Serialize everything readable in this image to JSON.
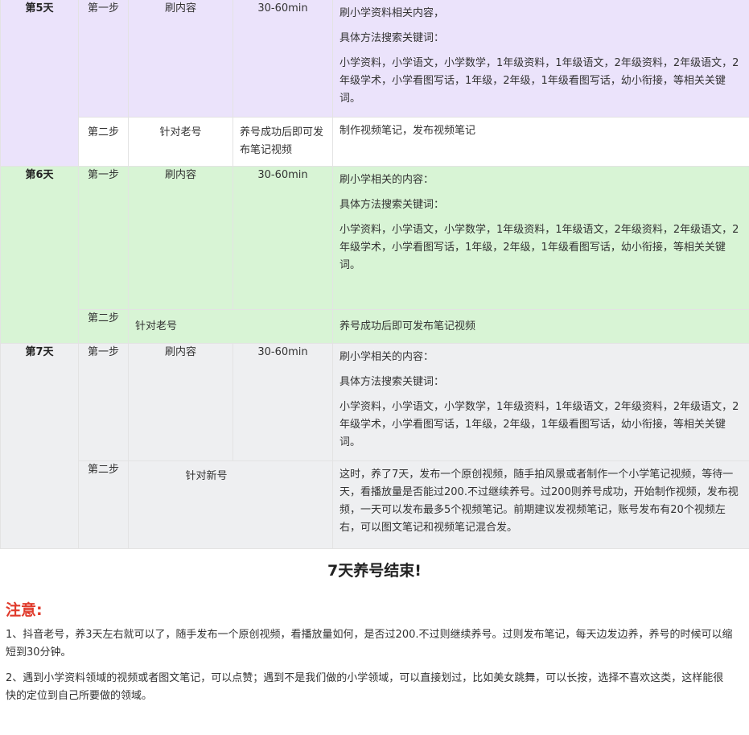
{
  "colors": {
    "day5": "#ebe3fb",
    "day6": "#d8f4d5",
    "day7": "#eeeff1",
    "notice": "#e03a2b"
  },
  "days": [
    {
      "label": "第5天",
      "step1": {
        "step": "第一步",
        "action": "刷内容",
        "time": "30-60min",
        "desc": [
          "刷小学资料相关内容，",
          "具体方法搜索关键词：",
          "小学资料，小学语文，小学数学，1年级资料，1年级语文，2年级资料，2年级语文，2年级学术，小学看图写话，1年级，2年级，1年级看图写话，幼小衔接，等相关关键词。"
        ]
      },
      "step2": {
        "step": "第二步",
        "action": "针对老号",
        "time": "养号成功后即可发布笔记视频",
        "desc": "制作视频笔记，发布视频笔记"
      }
    },
    {
      "label": "第6天",
      "step1": {
        "step": "第一步",
        "action": "刷内容",
        "time": "30-60min",
        "desc": [
          "刷小学相关的内容：",
          "具体方法搜索关键词：",
          "小学资料，小学语文，小学数学，1年级资料，1年级语文，2年级资料，2年级语文，2年级学术，小学看图写话，1年级，2年级，1年级看图写话，幼小衔接，等相关关键词。"
        ]
      },
      "step2": {
        "step": "第二步",
        "action": "针对老号",
        "desc": "养号成功后即可发布笔记视频"
      }
    },
    {
      "label": "第7天",
      "step1": {
        "step": "第一步",
        "action": "刷内容",
        "time": "30-60min",
        "desc": [
          "刷小学相关的内容：",
          "具体方法搜索关键词：",
          "小学资料，小学语文，小学数学，1年级资料，1年级语文，2年级资料，2年级语文，2年级学术，小学看图写话，1年级，2年级，1年级看图写话，幼小衔接，等相关关键词。"
        ]
      },
      "step2": {
        "step": "第二步",
        "action": "针对新号",
        "desc": "这时，养了7天，发布一个原创视频，随手拍风景或者制作一个小学笔记视频，等待一天，看播放量是否能过200.不过继续养号。过200则养号成功，开始制作视频，发布视频，一天可以发布最多5个视频笔记。前期建议发视频笔记，账号发布有20个视频左右，可以图文笔记和视频笔记混合发。"
      }
    }
  ],
  "ending": "7天养号结束!",
  "notes_title": "注意:",
  "notes": [
    "1、抖音老号，养3天左右就可以了，随手发布一个原创视频，看播放量如何，是否过200.不过则继续养号。过则发布笔记，每天边发边养，养号的时候可以缩短到30分钟。",
    "2、遇到小学资料领域的视频或者图文笔记，可以点赞；遇到不是我们做的小学领域，可以直接划过，比如美女跳舞，可以长按，选择不喜欢这类，这样能很快的定位到自己所要做的领域。"
  ]
}
